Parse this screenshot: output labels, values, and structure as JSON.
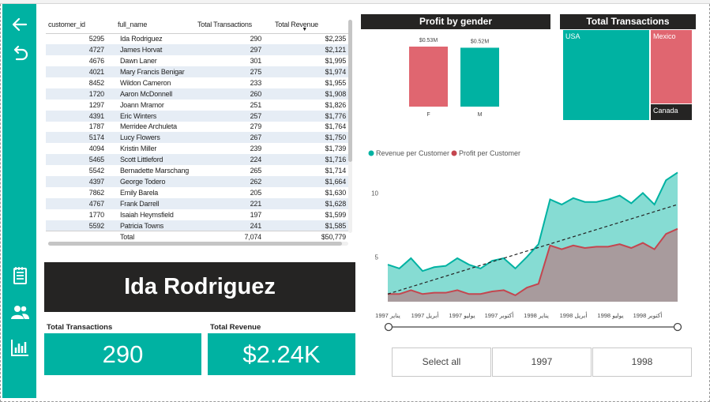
{
  "nav": {
    "icons": [
      "back-arrow-icon",
      "undo-icon",
      "report-page-icon",
      "people-icon",
      "bar-chart-icon"
    ]
  },
  "table": {
    "headers": [
      "customer_id",
      "full_name",
      "Total Transactions",
      "Total Revenue"
    ],
    "rows": [
      [
        "5295",
        "Ida Rodriguez",
        "290",
        "$2,235"
      ],
      [
        "4727",
        "James Horvat",
        "297",
        "$2,121"
      ],
      [
        "4676",
        "Dawn Laner",
        "301",
        "$1,995"
      ],
      [
        "4021",
        "Mary Francis Benigar",
        "275",
        "$1,974"
      ],
      [
        "8452",
        "Wildon Cameron",
        "233",
        "$1,955"
      ],
      [
        "1720",
        "Aaron McDonnell",
        "260",
        "$1,908"
      ],
      [
        "1297",
        "Joann Mramor",
        "251",
        "$1,826"
      ],
      [
        "4391",
        "Eric Winters",
        "257",
        "$1,776"
      ],
      [
        "1787",
        "Merridee Archuleta",
        "279",
        "$1,764"
      ],
      [
        "5174",
        "Lucy Flowers",
        "267",
        "$1,750"
      ],
      [
        "4094",
        "Kristin Miller",
        "239",
        "$1,739"
      ],
      [
        "5465",
        "Scott Littleford",
        "224",
        "$1,716"
      ],
      [
        "5542",
        "Bernadette Marschang",
        "265",
        "$1,714"
      ],
      [
        "4397",
        "George Todero",
        "262",
        "$1,664"
      ],
      [
        "7862",
        "Emily Barela",
        "205",
        "$1,630"
      ],
      [
        "4767",
        "Frank Darrell",
        "221",
        "$1,628"
      ],
      [
        "1770",
        "Isaiah Heymsfield",
        "197",
        "$1,599"
      ],
      [
        "5592",
        "Patricia Towns",
        "241",
        "$1,585"
      ]
    ],
    "total": {
      "label": "Total",
      "transactions": "7,074",
      "revenue": "$50,779"
    }
  },
  "selected_customer": {
    "name": "Ida Rodriguez"
  },
  "kpis": {
    "transactions_label": "Total Transactions",
    "transactions_value": "290",
    "revenue_label": "Total Revenue",
    "revenue_value": "$2.24K"
  },
  "slicer": {
    "buttons": [
      "Select all",
      "1997",
      "1998"
    ]
  },
  "colors": {
    "teal": "#00b2a2",
    "coral": "#e06670",
    "dark": "#252423",
    "revenue_area": "#86dcd3",
    "profit_area": "#a89b9d"
  },
  "chart_data": [
    {
      "type": "bar",
      "title": "Profit by gender",
      "categories": [
        "F",
        "M"
      ],
      "values": [
        0.53,
        0.52
      ],
      "data_labels": [
        "$0.53M",
        "$0.52M"
      ],
      "colors": [
        "#e06670",
        "#00b2a2"
      ]
    },
    {
      "type": "treemap",
      "title": "Total Transactions",
      "categories": [
        "USA",
        "Mexico",
        "Canada"
      ],
      "colors": [
        "#00b2a2",
        "#e06670",
        "#252423"
      ]
    },
    {
      "type": "area",
      "legend_position": "top-left",
      "series": [
        {
          "name": "Revenue per Customer",
          "color": "#00b2a2",
          "values": [
            4.4,
            4.1,
            4.9,
            3.9,
            4.2,
            4.3,
            4.9,
            4.4,
            4.1,
            4.7,
            4.9,
            4.1,
            5.0,
            6.0,
            9.5,
            9.1,
            9.6,
            9.3,
            9.3,
            9.5,
            9.8,
            9.2,
            10.0,
            9.1,
            11.0,
            11.6
          ]
        },
        {
          "name": "Profit per Customer",
          "color": "#c4464f",
          "values": [
            2.1,
            2.1,
            2.4,
            2.1,
            2.2,
            2.2,
            2.4,
            2.1,
            2.1,
            2.3,
            2.4,
            2.0,
            2.6,
            2.9,
            5.9,
            5.6,
            5.9,
            5.7,
            5.8,
            5.8,
            6.0,
            5.7,
            6.1,
            5.6,
            6.8,
            7.2
          ]
        }
      ],
      "trendline": {
        "start": 2.1,
        "end": 9.1
      },
      "yticks": [
        "5",
        "10"
      ],
      "ylim": [
        1.5,
        12
      ],
      "xticks": [
        "يناير 1997",
        "أبريل 1997",
        "يوليو 1997",
        "أكتوبر 1997",
        "يناير 1998",
        "أبريل 1998",
        "يوليو 1998",
        "أكتوبر 1998"
      ]
    }
  ]
}
